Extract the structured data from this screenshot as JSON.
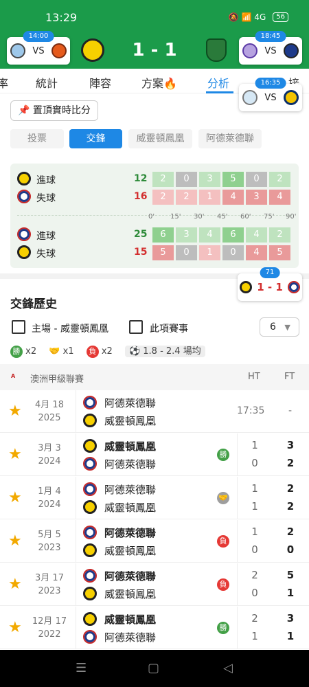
{
  "status": {
    "time": "13:29",
    "icons": "🔕 📶 4G",
    "battery": "56"
  },
  "header": {
    "score": "1 - 1",
    "left_card": {
      "time": "14:00",
      "vs": "VS"
    },
    "right_card": {
      "time": "18:45",
      "vs": "VS"
    },
    "float_card": {
      "time": "16:35",
      "vs": "VS"
    }
  },
  "tabs": [
    "率",
    "統計",
    "陣容",
    "方案",
    "分析",
    "接"
  ],
  "pin_button": "置頂實時比分",
  "segments": [
    "投票",
    "交鋒",
    "威靈頓鳳凰",
    "阿德萊德聯"
  ],
  "stats": {
    "rows": [
      {
        "label": "進球",
        "total": "12",
        "cells": [
          "2",
          "0",
          "3",
          "5",
          "0",
          "2"
        ]
      },
      {
        "label": "失球",
        "total": "16",
        "cells": [
          "2",
          "2",
          "1",
          "4",
          "3",
          "4"
        ]
      },
      {
        "label": "進球",
        "total": "25",
        "cells": [
          "6",
          "3",
          "4",
          "6",
          "4",
          "2"
        ]
      },
      {
        "label": "失球",
        "total": "15",
        "cells": [
          "5",
          "0",
          "1",
          "0",
          "4",
          "5"
        ]
      }
    ],
    "minutes": [
      "0'",
      "15'",
      "30'",
      "45'",
      "60'",
      "75'",
      "90'"
    ]
  },
  "live_badge": {
    "minute": "71",
    "score": "1 - 1"
  },
  "h2h": {
    "title": "交鋒歷史",
    "filter_home": "主場 - 威靈頓鳳凰",
    "filter_comp": "此項賽事",
    "count": "6",
    "legend": {
      "win": "勝",
      "win_count": "x2",
      "draw_count": "x1",
      "loss": "負",
      "loss_count": "x2",
      "avg": "1.8 - 2.4 場均"
    }
  },
  "league": {
    "name": "澳洲甲級聯賽",
    "ht": "HT",
    "ft": "FT"
  },
  "matches": [
    {
      "date": "4月 18",
      "year": "2025",
      "home": "阿德萊德聯",
      "away": "威靈頓鳳凰",
      "ht": "17:35",
      "ft": "-",
      "result": ""
    },
    {
      "date": "3月 3",
      "year": "2024",
      "home": "威靈頓鳳凰",
      "away": "阿德萊德聯",
      "ht_h": "1",
      "ht_a": "0",
      "ft_h": "3",
      "ft_a": "2",
      "result": "勝"
    },
    {
      "date": "1月 4",
      "year": "2024",
      "home": "阿德萊德聯",
      "away": "威靈頓鳳凰",
      "ht_h": "1",
      "ht_a": "1",
      "ft_h": "2",
      "ft_a": "2",
      "result": "draw"
    },
    {
      "date": "5月 5",
      "year": "2023",
      "home": "阿德萊德聯",
      "away": "威靈頓鳳凰",
      "ht_h": "1",
      "ht_a": "0",
      "ft_h": "2",
      "ft_a": "0",
      "result": "負"
    },
    {
      "date": "3月 17",
      "year": "2023",
      "home": "阿德萊德聯",
      "away": "威靈頓鳳凰",
      "ht_h": "2",
      "ht_a": "0",
      "ft_h": "5",
      "ft_a": "1",
      "result": "負"
    },
    {
      "date": "12月 17",
      "year": "2022",
      "home": "威靈頓鳳凰",
      "away": "阿德萊德聯",
      "ht_h": "2",
      "ht_a": "1",
      "ft_h": "3",
      "ft_a": "1",
      "result": "勝"
    }
  ],
  "colors": {
    "brand_green": "#1b9b4a",
    "accent_blue": "#1e88e5",
    "win": "#43a047",
    "loss": "#e53935",
    "draw": "#9e9e9e",
    "star": "#f2a900"
  }
}
